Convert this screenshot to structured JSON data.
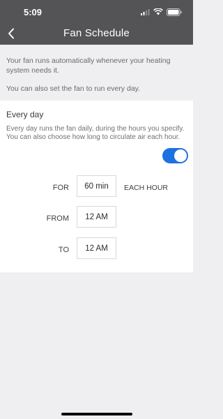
{
  "status_bar": {
    "time": "5:09"
  },
  "nav": {
    "title": "Fan Schedule",
    "back_icon": "chevron-left-icon"
  },
  "intro": {
    "line1": "Your fan runs automatically whenever your heating system needs it.",
    "line2": "You can also set the fan to run every day."
  },
  "every_day": {
    "title": "Every day",
    "description": "Every day runs the fan daily, during the hours you specify. You can also choose how long to circulate air each hour.",
    "enabled": true,
    "accent_color": "#1c72e0"
  },
  "schedule": {
    "for_label": "FOR",
    "for_value": "60 min",
    "for_suffix": "EACH HOUR",
    "from_label": "FROM",
    "from_value": "12 AM",
    "to_label": "TO",
    "to_value": "12 AM"
  }
}
